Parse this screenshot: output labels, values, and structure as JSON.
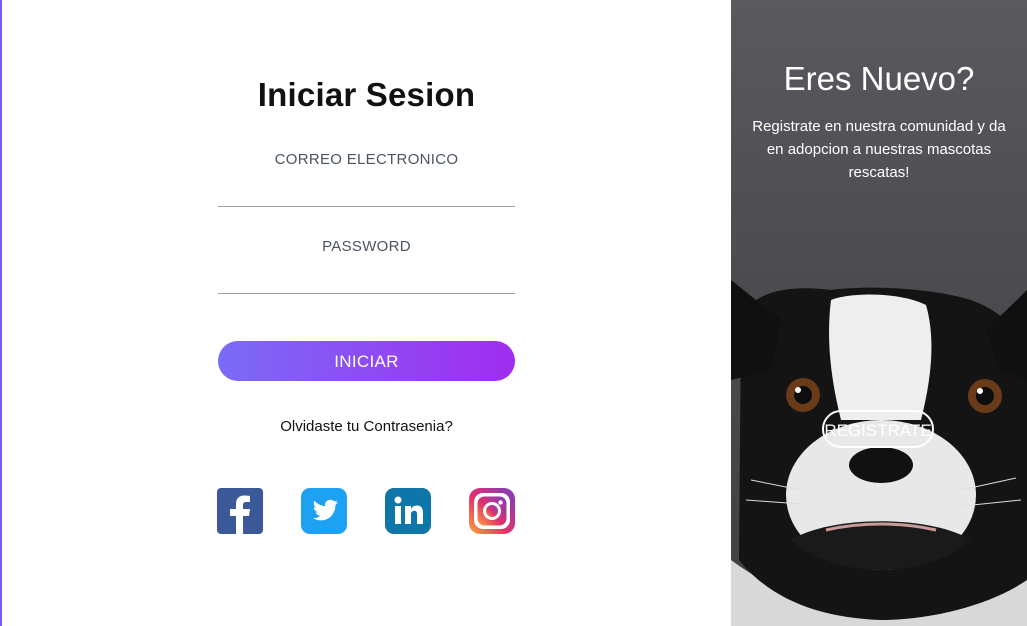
{
  "login": {
    "title": "Iniciar Sesion",
    "email_label": "CORREO ELECTRONICO",
    "email_value": "",
    "password_label": "PASSWORD",
    "password_value": "",
    "submit_label": "INICIAR",
    "forgot_label": "Olvidaste tu Contrasenia?",
    "social": [
      {
        "name": "facebook",
        "icon": "facebook-icon",
        "color": "#3b5998"
      },
      {
        "name": "twitter",
        "icon": "twitter-icon",
        "color": "#1da1f2"
      },
      {
        "name": "linkedin",
        "icon": "linkedin-icon",
        "color": "#0e76a8"
      },
      {
        "name": "instagram",
        "icon": "instagram-icon",
        "color": "#c13584"
      }
    ],
    "accent_gradient": [
      "#7a6cf6",
      "#a12cf0"
    ]
  },
  "promo": {
    "title": "Eres Nuevo?",
    "text": "Registrate en nuestra comunidad y da en adopcion a nuestras mascotas rescatas!",
    "register_label": "REGISTRATE",
    "background_color": "#4c4c50"
  }
}
